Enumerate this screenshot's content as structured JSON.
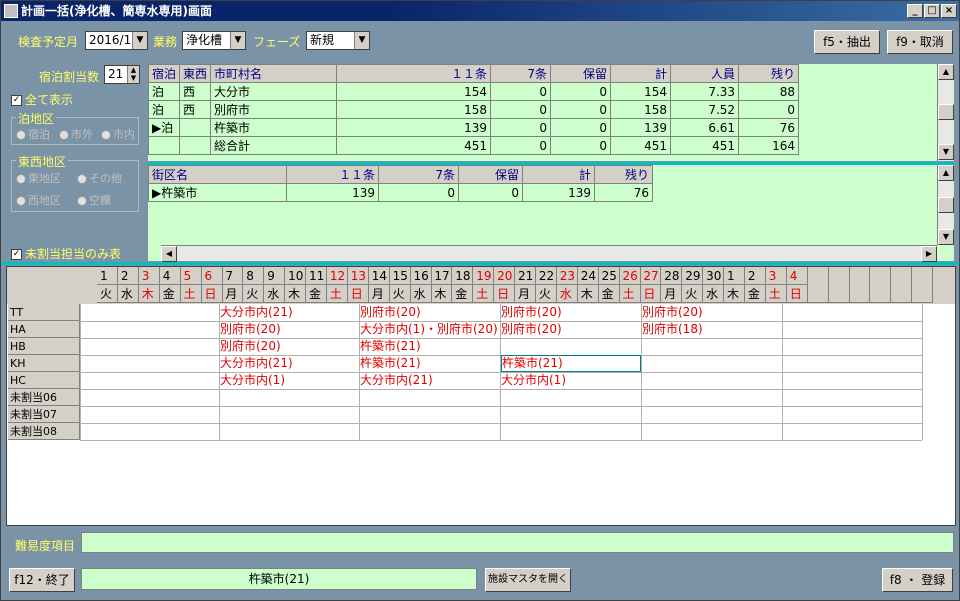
{
  "window": {
    "title": "計画一括(浄化槽、簡専水専用)画面"
  },
  "filters": {
    "month_label": "検査予定月",
    "month_value": "2016/11",
    "business_label": "業務",
    "business_value": "浄化槽",
    "phase_label": "フェーズ",
    "phase_value": "新規"
  },
  "buttons": {
    "extract": "f5・抽出",
    "cancel": "f9・取消",
    "close": "f12・終了",
    "facility": "施設マスタを開く",
    "register": "f8 ・ 登録"
  },
  "left": {
    "stay_count_label": "宿泊割当数",
    "stay_count_value": "21",
    "show_all": "全て表示",
    "stay_area_title": "泊地区",
    "stay_area_opts": [
      "宿泊",
      "市外",
      "市内"
    ],
    "ew_title": "東西地区",
    "ew_opts": [
      "東地区",
      "その他",
      "西地区",
      "空欄"
    ],
    "unassigned_only": "未割当担当のみ表"
  },
  "city_table": {
    "headers": [
      "宿泊",
      "東西",
      "市町村名",
      "１１条",
      "7条",
      "保留",
      "計",
      "人員",
      "残り"
    ],
    "rows": [
      [
        "泊",
        "西",
        "大分市",
        "154",
        "0",
        "0",
        "154",
        "7.33",
        "88"
      ],
      [
        "泊",
        "西",
        "別府市",
        "158",
        "0",
        "0",
        "158",
        "7.52",
        "0"
      ],
      [
        "泊",
        "",
        "杵築市",
        "139",
        "0",
        "0",
        "139",
        "6.61",
        "76"
      ],
      [
        "",
        "",
        "総合計",
        "451",
        "0",
        "0",
        "451",
        "451",
        "164"
      ]
    ]
  },
  "district_table": {
    "headers": [
      "街区名",
      "１１条",
      "7条",
      "保留",
      "計",
      "残り"
    ],
    "rows": [
      [
        "杵築市",
        "139",
        "0",
        "0",
        "139",
        "76"
      ]
    ]
  },
  "calendar": {
    "days": [
      "1",
      "2",
      "3",
      "4",
      "5",
      "6",
      "7",
      "8",
      "9",
      "10",
      "11",
      "12",
      "13",
      "14",
      "15",
      "16",
      "17",
      "18",
      "19",
      "20",
      "21",
      "22",
      "23",
      "24",
      "25",
      "26",
      "27",
      "28",
      "29",
      "30",
      "1",
      "2",
      "3",
      "4"
    ],
    "weekdays": [
      "火",
      "水",
      "木",
      "金",
      "土",
      "日",
      "月",
      "火",
      "水",
      "木",
      "金",
      "土",
      "日",
      "月",
      "火",
      "水",
      "木",
      "金",
      "土",
      "日",
      "月",
      "火",
      "水",
      "木",
      "金",
      "土",
      "日",
      "月",
      "火",
      "水",
      "木",
      "金",
      "土",
      "日"
    ],
    "red_idx": [
      2,
      4,
      5,
      11,
      12,
      18,
      19,
      22,
      25,
      26,
      32,
      33
    ],
    "staff": [
      "TT",
      "HA",
      "HB",
      "KH",
      "HC",
      "未割当06",
      "未割当07",
      "未割当08"
    ],
    "events": [
      {
        "row": 0,
        "week": 0,
        "text": "大分市内(21)"
      },
      {
        "row": 0,
        "week": 1,
        "text": "別府市(20)"
      },
      {
        "row": 0,
        "week": 2,
        "text": "別府市(20)"
      },
      {
        "row": 0,
        "week": 3,
        "text": "別府市(20)"
      },
      {
        "row": 1,
        "week": 0,
        "text": "別府市(20)"
      },
      {
        "row": 1,
        "week": 1,
        "text": "大分市内(1)・別府市(20)"
      },
      {
        "row": 1,
        "week": 2,
        "text": "別府市(20)"
      },
      {
        "row": 1,
        "week": 3,
        "text": "別府市(18)"
      },
      {
        "row": 2,
        "week": 0,
        "text": "別府市(20)"
      },
      {
        "row": 2,
        "week": 1,
        "text": "杵築市(21)"
      },
      {
        "row": 3,
        "week": 0,
        "text": "大分市内(21)"
      },
      {
        "row": 3,
        "week": 1,
        "text": "杵築市(21)"
      },
      {
        "row": 3,
        "week": 2,
        "text": "杵築市(21)"
      },
      {
        "row": 4,
        "week": 0,
        "text": "大分市内(1)"
      },
      {
        "row": 4,
        "week": 1,
        "text": "大分市内(21)"
      },
      {
        "row": 4,
        "week": 2,
        "text": "大分市内(1)"
      }
    ]
  },
  "difficulty_label": "難易度項目",
  "status_text": "杵築市(21)"
}
